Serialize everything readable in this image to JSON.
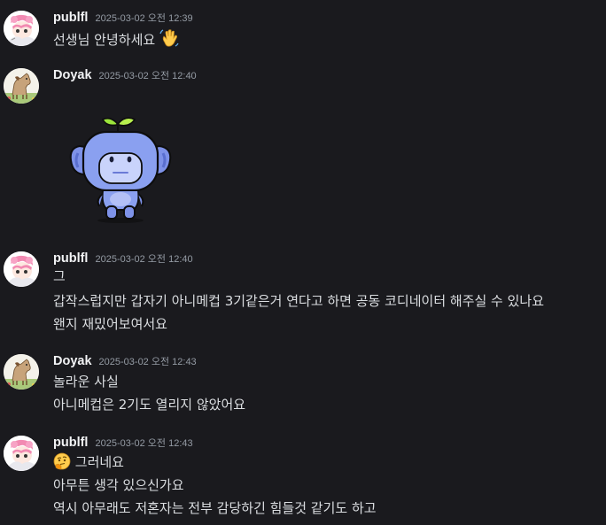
{
  "messages": [
    {
      "username": "publfl",
      "timestamp": "2025-03-02 오전 12:39",
      "lines": [
        "선생님 안녕하세요"
      ],
      "emoji": "waving-hand"
    },
    {
      "username": "Doyak",
      "timestamp": "2025-03-02 오전 12:40",
      "lines": [],
      "sticker": "discord-wumpus-sticker"
    },
    {
      "username": "publfl",
      "timestamp": "2025-03-02 오전 12:40",
      "lines": [
        "그",
        "갑작스럽지만 갑자기 아니메컵 3기같은거 연다고 하면 공동 코디네이터 해주실 수 있나요",
        "왠지 재밌어보여서요"
      ]
    },
    {
      "username": "Doyak",
      "timestamp": "2025-03-02 오전 12:43",
      "lines": [
        "놀라운 사실",
        "아니메컵은 2기도 열리지 않았어요"
      ]
    },
    {
      "username": "publfl",
      "timestamp": "2025-03-02 오전 12:43",
      "lines": [
        "그러네요",
        "아무튼 생각 있으신가요",
        "역시 아무래도 저혼자는 전부 감당하긴 힘들것 같기도 하고"
      ],
      "emoji": "thinking-face"
    }
  ]
}
